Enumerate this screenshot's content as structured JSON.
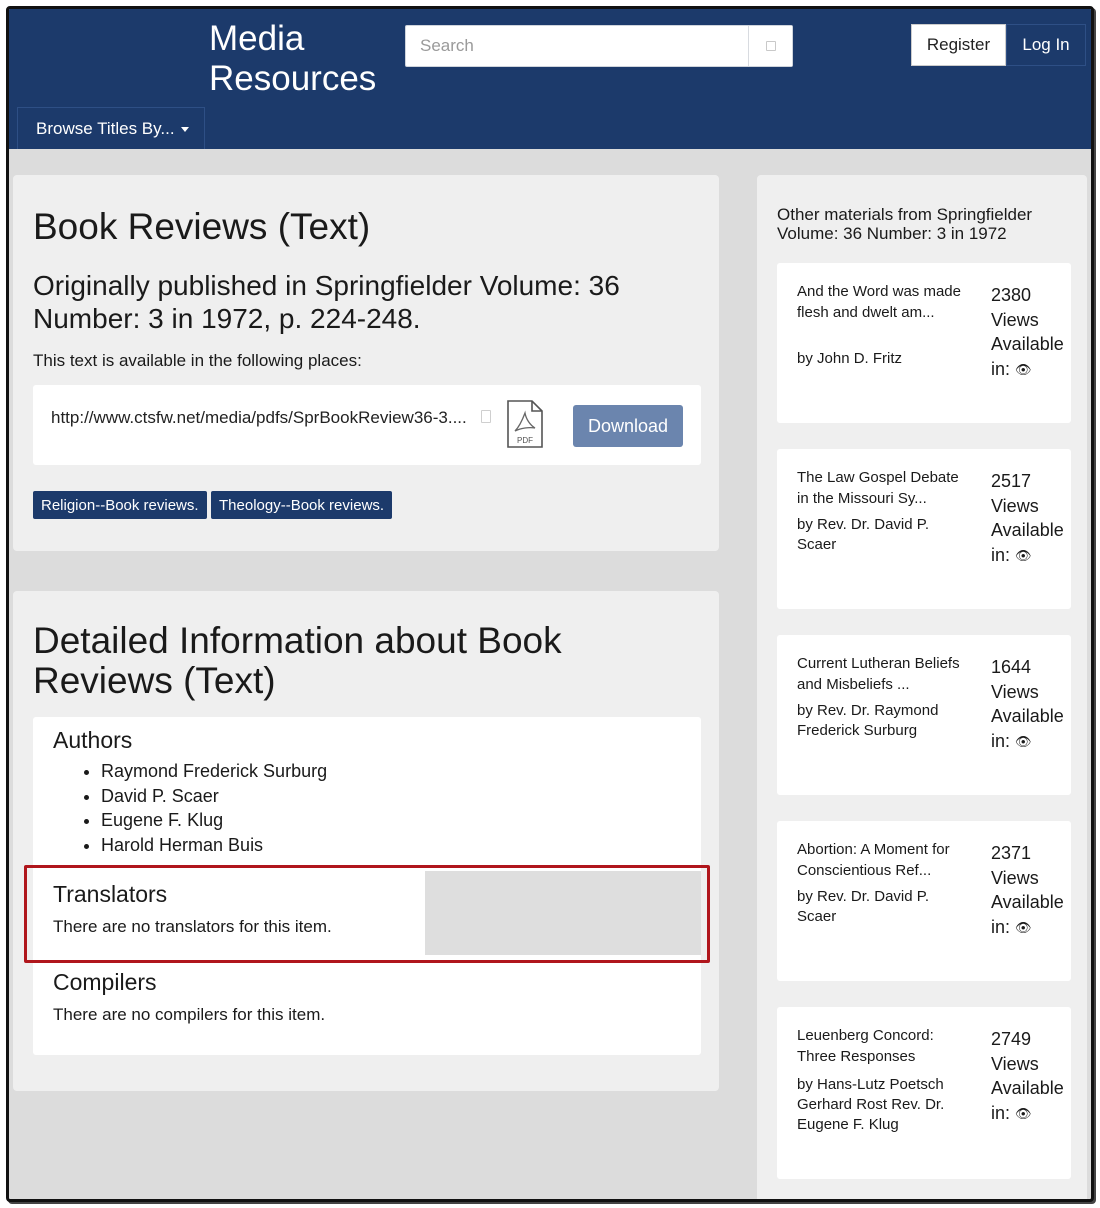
{
  "header": {
    "brand_line1": "Media",
    "brand_line2": "Resources",
    "search_placeholder": "Search",
    "register_label": "Register",
    "login_label": "Log In",
    "browse_label": "Browse Titles By..."
  },
  "main": {
    "title": "Book Reviews (Text)",
    "subtitle": "Originally published in Springfielder Volume: 36 Number: 3 in 1972, p. 224-248.",
    "available_text": "This text is available in the following places:",
    "link_url": "http://www.ctsfw.net/media/pdfs/SprBookReview36-3....",
    "pdf_label": "PDF",
    "download_label": "Download",
    "tags": [
      "Religion--Book reviews.",
      "Theology--Book reviews."
    ]
  },
  "detail": {
    "title": "Detailed Information about Book Reviews (Text)",
    "authors_title": "Authors",
    "authors": [
      "Raymond Frederick Surburg",
      "David P. Scaer",
      "Eugene F. Klug",
      "Harold Herman Buis"
    ],
    "translators_title": "Translators",
    "translators_text": "There are no translators for this item.",
    "compilers_title": "Compilers",
    "compilers_text": "There are no compilers for this item."
  },
  "sidebar": {
    "heading": "Other materials from Springfielder Volume: 36 Number: 3 in 1972",
    "views_label": "Views",
    "available_label": "Available",
    "in_label": "in:",
    "items": [
      {
        "title": "And the Word was made flesh and dwelt am...",
        "author": "by John D. Fritz",
        "views": "2380"
      },
      {
        "title": "The Law Gospel Debate in the Missouri Sy...",
        "author": "by Rev. Dr. David P. Scaer",
        "views": "2517"
      },
      {
        "title": "Current Lutheran Beliefs and Misbeliefs ...",
        "author": "by Rev. Dr. Raymond Frederick Surburg",
        "views": "1644"
      },
      {
        "title": "Abortion: A Moment for Conscientious Ref...",
        "author": "by Rev. Dr. David P. Scaer",
        "views": "2371"
      },
      {
        "title": "Leuenberg Concord: Three Responses",
        "author": "by Hans-Lutz Poetsch Gerhard Rost Rev. Dr. Eugene F. Klug",
        "views": "2749"
      }
    ]
  },
  "colors": {
    "header_bg": "#1c3a6b",
    "download_bg": "#6b85ae",
    "highlight_border": "#b0161c"
  }
}
